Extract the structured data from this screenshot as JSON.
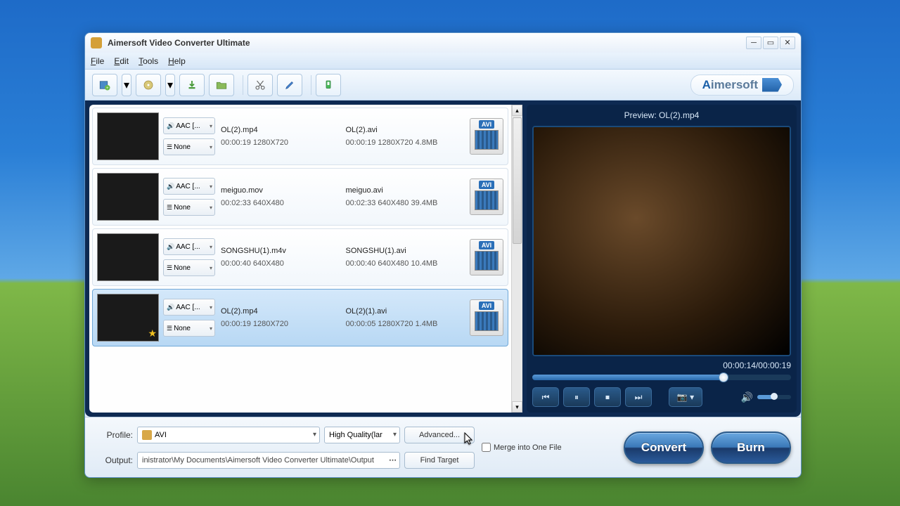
{
  "app": {
    "title": "Aimersoft Video Converter Ultimate",
    "brand_a": "A",
    "brand_rest": "imersoft"
  },
  "menu": {
    "file": "File",
    "edit": "Edit",
    "tools": "Tools",
    "help": "Help"
  },
  "files": [
    {
      "src_name": "OL(2).mp4",
      "src_meta": "00:00:19  1280X720",
      "dst_name": "OL(2).avi",
      "dst_meta": "00:00:19  1280X720  4.8MB",
      "audio": "AAC [...",
      "sub": "None",
      "badge": "AVI",
      "selected": false,
      "star": false
    },
    {
      "src_name": "meiguo.mov",
      "src_meta": "00:02:33  640X480",
      "dst_name": "meiguo.avi",
      "dst_meta": "00:02:33  640X480  39.4MB",
      "audio": "AAC [...",
      "sub": "None",
      "badge": "AVI",
      "selected": false,
      "star": false
    },
    {
      "src_name": "SONGSHU(1).m4v",
      "src_meta": "00:00:40  640X480",
      "dst_name": "SONGSHU(1).avi",
      "dst_meta": "00:00:40  640X480  10.4MB",
      "audio": "AAC [...",
      "sub": "None",
      "badge": "AVI",
      "selected": false,
      "star": false
    },
    {
      "src_name": "OL(2).mp4",
      "src_meta": "00:00:19  1280X720",
      "dst_name": "OL(2)(1).avi",
      "dst_meta": "00:00:05  1280X720  1.4MB",
      "audio": "AAC [...",
      "sub": "None",
      "badge": "AVI",
      "selected": true,
      "star": true
    }
  ],
  "preview": {
    "title": "Preview: OL(2).mp4",
    "time": "00:00:14/00:00:19"
  },
  "bottom": {
    "profile_label": "Profile:",
    "profile_value": "AVI",
    "quality": "High Quality(lar",
    "advanced": "Advanced...",
    "output_label": "Output:",
    "output_path": "inistrator\\My Documents\\Aimersoft Video Converter Ultimate\\Output",
    "find_target": "Find Target",
    "merge": "Merge into One File",
    "convert": "Convert",
    "burn": "Burn"
  }
}
